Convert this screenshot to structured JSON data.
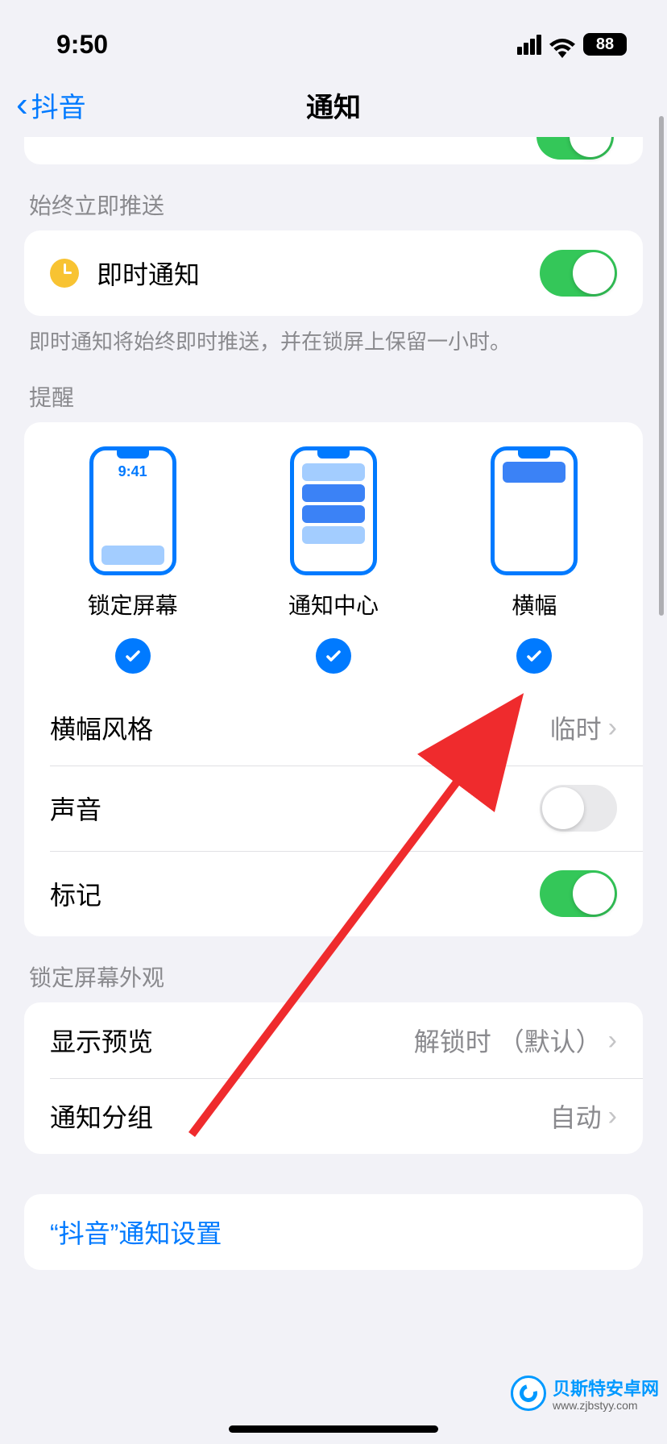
{
  "status": {
    "time": "9:50",
    "battery": "88"
  },
  "nav": {
    "back": "抖音",
    "title": "通知"
  },
  "topToggle": {
    "on": true
  },
  "instant": {
    "header": "始终立即推送",
    "label": "即时通知",
    "on": true,
    "footer": "即时通知将始终即时推送，并在锁屏上保留一小时。"
  },
  "alerts": {
    "header": "提醒",
    "options": [
      {
        "label": "锁定屏幕",
        "time": "9:41",
        "checked": true
      },
      {
        "label": "通知中心",
        "checked": true
      },
      {
        "label": "横幅",
        "checked": true
      }
    ]
  },
  "bannerStyle": {
    "label": "横幅风格",
    "value": "临时"
  },
  "sound": {
    "label": "声音",
    "on": false
  },
  "badges": {
    "label": "标记",
    "on": true
  },
  "lockAppearance": {
    "header": "锁定屏幕外观",
    "preview": {
      "label": "显示预览",
      "value": "解锁时 （默认）"
    },
    "grouping": {
      "label": "通知分组",
      "value": "自动"
    }
  },
  "appSettings": {
    "label": "“抖音”通知设置"
  },
  "watermark": {
    "brand": "贝斯特安卓网",
    "url": "www.zjbstyy.com"
  }
}
